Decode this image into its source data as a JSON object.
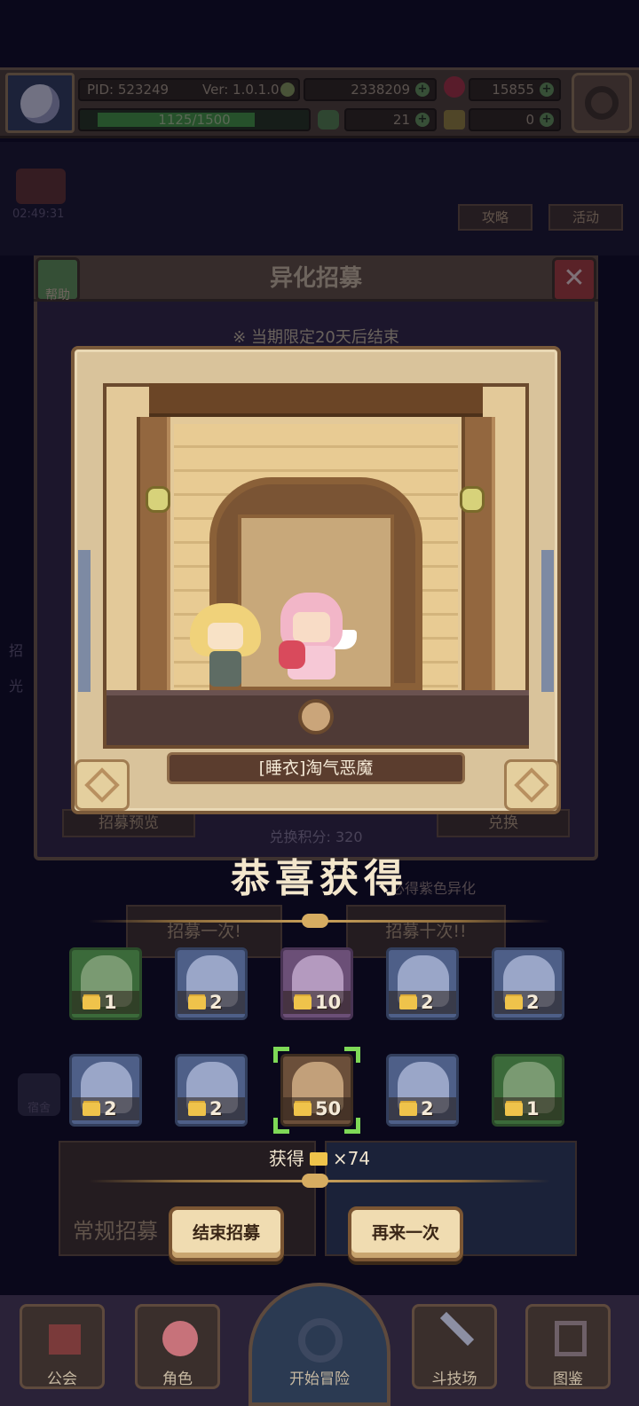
{
  "status": {
    "pid": "PID: 523249",
    "version": "Ver: 1.0.1.0",
    "gold": "2338209",
    "gems": "15855",
    "xp_text": "1125/1500",
    "xp_fraction": 0.75,
    "clover": "21",
    "keys": "0"
  },
  "background": {
    "timer": "02:49:31",
    "strategy_label": "攻略",
    "activity_label": "活动",
    "left_side_1": "招",
    "left_side_2": "光",
    "left_side_3": "宿舍"
  },
  "panel": {
    "title": "异化招募",
    "help_label": "帮助",
    "close_glyph": "✕",
    "notice": "※ 当期限定20天后结束",
    "preview_button": "招募预览",
    "exchange_button": "兑换",
    "points": "兑换积分: 320",
    "guarantee": "必得紫色异化",
    "recruit_once": "招募一次!",
    "recruit_ten": "招募十次!!",
    "normal_recruit": "常规招募"
  },
  "reward_card": {
    "name": "[睡衣]淘气恶魔"
  },
  "congrats": "恭喜获得",
  "items": [
    {
      "qty": "1",
      "rarity": "green"
    },
    {
      "qty": "2",
      "rarity": "blue"
    },
    {
      "qty": "10",
      "rarity": "purple"
    },
    {
      "qty": "2",
      "rarity": "blue"
    },
    {
      "qty": "2",
      "rarity": "blue"
    },
    {
      "qty": "2",
      "rarity": "blue"
    },
    {
      "qty": "2",
      "rarity": "blue"
    },
    {
      "qty": "50",
      "rarity": "brown",
      "selected": true
    },
    {
      "qty": "2",
      "rarity": "blue"
    },
    {
      "qty": "1",
      "rarity": "green"
    }
  ],
  "total": {
    "label": "获得",
    "count": "×74"
  },
  "buttons": {
    "end": "结束招募",
    "again": "再来一次"
  },
  "nav": {
    "guild": "公会",
    "role": "角色",
    "adventure": "开始冒险",
    "arena": "斗技场",
    "codex": "图鉴"
  },
  "colors": {
    "accent": "#efc34b",
    "selected": "#7ed957",
    "button": "#f0dcb1"
  }
}
